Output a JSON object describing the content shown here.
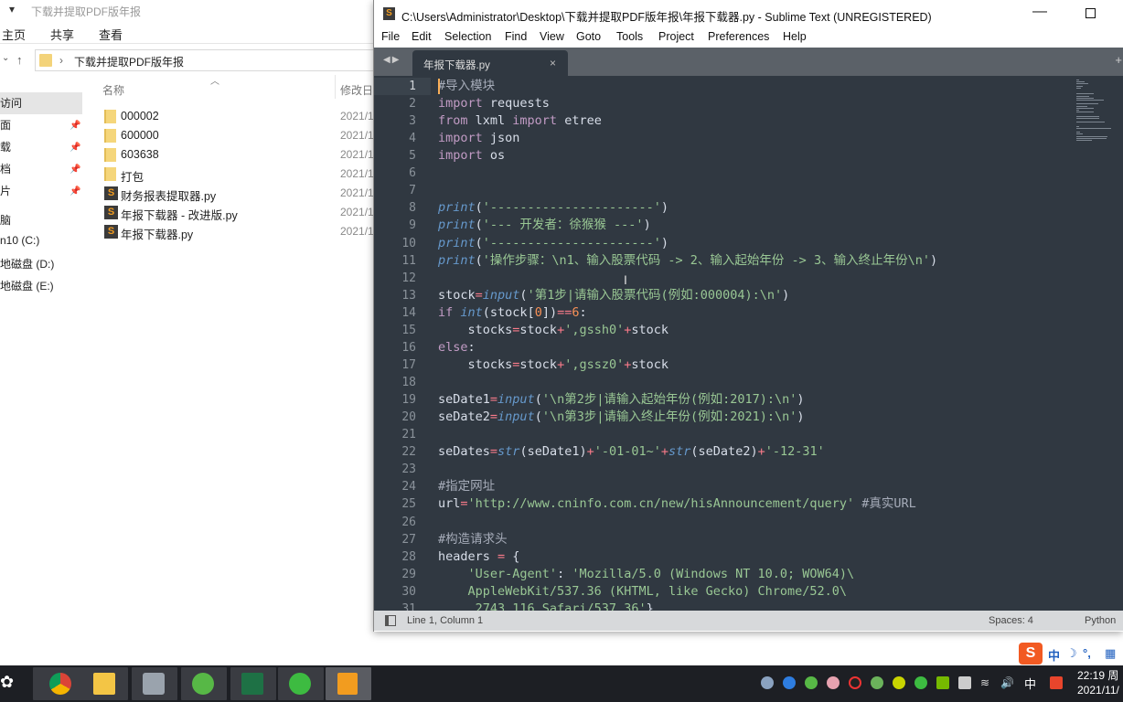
{
  "explorer": {
    "title": "下载并提取PDF版年报",
    "ribbon_tabs": [
      "主页",
      "共享",
      "查看"
    ],
    "address_path": "下载并提取PDF版年报",
    "sidebar": [
      {
        "label": "访问",
        "pinned": false
      },
      {
        "label": "面",
        "pinned": true
      },
      {
        "label": "载",
        "pinned": true
      },
      {
        "label": "档",
        "pinned": true
      },
      {
        "label": "片",
        "pinned": true
      },
      {
        "label": "脑",
        "pinned": false
      },
      {
        "label": "n10 (C:)",
        "pinned": false
      },
      {
        "label": "地磁盘 (D:)",
        "pinned": false
      },
      {
        "label": "地磁盘 (E:)",
        "pinned": false
      }
    ],
    "columns": {
      "name": "名称",
      "modified": "修改日"
    },
    "files": [
      {
        "name": "000002",
        "type": "folder",
        "date": "2021/1"
      },
      {
        "name": "600000",
        "type": "folder",
        "date": "2021/1"
      },
      {
        "name": "603638",
        "type": "folder",
        "date": "2021/1"
      },
      {
        "name": "打包",
        "type": "folder",
        "date": "2021/1"
      },
      {
        "name": "财务报表提取器.py",
        "type": "py",
        "date": "2021/1"
      },
      {
        "name": "年报下载器 - 改进版.py",
        "type": "py",
        "date": "2021/1"
      },
      {
        "name": "年报下载器.py",
        "type": "py",
        "date": "2021/1"
      }
    ]
  },
  "sublime": {
    "title": "C:\\Users\\Administrator\\Desktop\\下载并提取PDF版年报\\年报下载器.py - Sublime Text (UNREGISTERED)",
    "menu": [
      "File",
      "Edit",
      "Selection",
      "Find",
      "View",
      "Goto",
      "Tools",
      "Project",
      "Preferences",
      "Help"
    ],
    "tab": "年报下载器.py",
    "status": {
      "position": "Line 1, Column 1",
      "indent": "Spaces: 4",
      "syntax": "Python"
    },
    "code": [
      [
        [
          "#导入模块",
          "c"
        ]
      ],
      [
        [
          "import",
          "k"
        ],
        [
          " requests",
          "p"
        ]
      ],
      [
        [
          "from",
          "k"
        ],
        [
          " lxml ",
          "p"
        ],
        [
          "import",
          "k"
        ],
        [
          " etree",
          "p"
        ]
      ],
      [
        [
          "import",
          "k"
        ],
        [
          " json",
          "p"
        ]
      ],
      [
        [
          "import",
          "k"
        ],
        [
          " os",
          "p"
        ]
      ],
      [],
      [],
      [
        [
          "print",
          "f"
        ],
        [
          "(",
          "p"
        ],
        [
          "'----------------------'",
          "s"
        ],
        [
          ")",
          "p"
        ]
      ],
      [
        [
          "print",
          "f"
        ],
        [
          "(",
          "p"
        ],
        [
          "'--- 开发者：徐猴猴 ---'",
          "s"
        ],
        [
          ")",
          "p"
        ]
      ],
      [
        [
          "print",
          "f"
        ],
        [
          "(",
          "p"
        ],
        [
          "'----------------------'",
          "s"
        ],
        [
          ")",
          "p"
        ]
      ],
      [
        [
          "print",
          "f"
        ],
        [
          "(",
          "p"
        ],
        [
          "'操作步骤：\\n1、输入股票代码 -> 2、输入起始年份 -> 3、输入终止年份\\n'",
          "s"
        ],
        [
          ")",
          "p"
        ]
      ],
      [],
      [
        [
          "stock",
          "p"
        ],
        [
          "=",
          "o"
        ],
        [
          "input",
          "f"
        ],
        [
          "(",
          "p"
        ],
        [
          "'第1步|请输入股票代码(例如:000004):\\n'",
          "s"
        ],
        [
          ")",
          "p"
        ]
      ],
      [
        [
          "if",
          "k"
        ],
        [
          " ",
          "p"
        ],
        [
          "int",
          "f"
        ],
        [
          "(stock[",
          "p"
        ],
        [
          "0",
          "n"
        ],
        [
          "])",
          "p"
        ],
        [
          "==",
          "o"
        ],
        [
          "6",
          "n"
        ],
        [
          ":",
          "p"
        ]
      ],
      [
        [
          "    stocks",
          "p"
        ],
        [
          "=",
          "o"
        ],
        [
          "stock",
          "p"
        ],
        [
          "+",
          "o"
        ],
        [
          "',gssh0'",
          "s"
        ],
        [
          "+",
          "o"
        ],
        [
          "stock",
          "p"
        ]
      ],
      [
        [
          "else",
          "k"
        ],
        [
          ":",
          "p"
        ]
      ],
      [
        [
          "    stocks",
          "p"
        ],
        [
          "=",
          "o"
        ],
        [
          "stock",
          "p"
        ],
        [
          "+",
          "o"
        ],
        [
          "',gssz0'",
          "s"
        ],
        [
          "+",
          "o"
        ],
        [
          "stock",
          "p"
        ]
      ],
      [],
      [
        [
          "seDate1",
          "p"
        ],
        [
          "=",
          "o"
        ],
        [
          "input",
          "f"
        ],
        [
          "(",
          "p"
        ],
        [
          "'\\n第2步|请输入起始年份(例如:2017):\\n'",
          "s"
        ],
        [
          ")",
          "p"
        ]
      ],
      [
        [
          "seDate2",
          "p"
        ],
        [
          "=",
          "o"
        ],
        [
          "input",
          "f"
        ],
        [
          "(",
          "p"
        ],
        [
          "'\\n第3步|请输入终止年份(例如:2021):\\n'",
          "s"
        ],
        [
          ")",
          "p"
        ]
      ],
      [],
      [
        [
          "seDates",
          "p"
        ],
        [
          "=",
          "o"
        ],
        [
          "str",
          "f"
        ],
        [
          "(seDate1)",
          "p"
        ],
        [
          "+",
          "o"
        ],
        [
          "'-01-01~'",
          "s"
        ],
        [
          "+",
          "o"
        ],
        [
          "str",
          "f"
        ],
        [
          "(seDate2)",
          "p"
        ],
        [
          "+",
          "o"
        ],
        [
          "'-12-31'",
          "s"
        ]
      ],
      [],
      [
        [
          "#指定网址",
          "c"
        ]
      ],
      [
        [
          "url",
          "p"
        ],
        [
          "=",
          "o"
        ],
        [
          "'http://www.cninfo.com.cn/new/hisAnnouncement/query'",
          "s"
        ],
        [
          " #真实URL",
          "c"
        ]
      ],
      [],
      [
        [
          "#构造请求头",
          "c"
        ]
      ],
      [
        [
          "headers ",
          "p"
        ],
        [
          "=",
          "o"
        ],
        [
          " {",
          "p"
        ]
      ],
      [
        [
          "    ",
          "p"
        ],
        [
          "'User-Agent'",
          "s"
        ],
        [
          ": ",
          "p"
        ],
        [
          "'Mozilla/5.0 (Windows NT 10.0; WOW64)\\",
          "s"
        ]
      ],
      [
        [
          "    AppleWebKit/537.36 (KHTML, like Gecko) Chrome/52.0\\",
          "s"
        ]
      ],
      [
        [
          "     2743.116 Safari/537.36'",
          "s"
        ],
        [
          "}",
          "p"
        ]
      ]
    ]
  },
  "ime": {
    "mode": "中"
  },
  "taskbar": {
    "apps": [
      "chrome",
      "file-explorer",
      "on-screen-keyboard",
      "browser-e",
      "excel",
      "wechat",
      "sublime-text"
    ],
    "tray_lang": "中",
    "time": "22:19 周",
    "date": "2021/11/"
  },
  "colors": {
    "editor_bg": "#303841",
    "string": "#99c794",
    "keyword": "#c19bc4",
    "function": "#6699cc",
    "operator": "#f97b8a",
    "number": "#f99157"
  }
}
